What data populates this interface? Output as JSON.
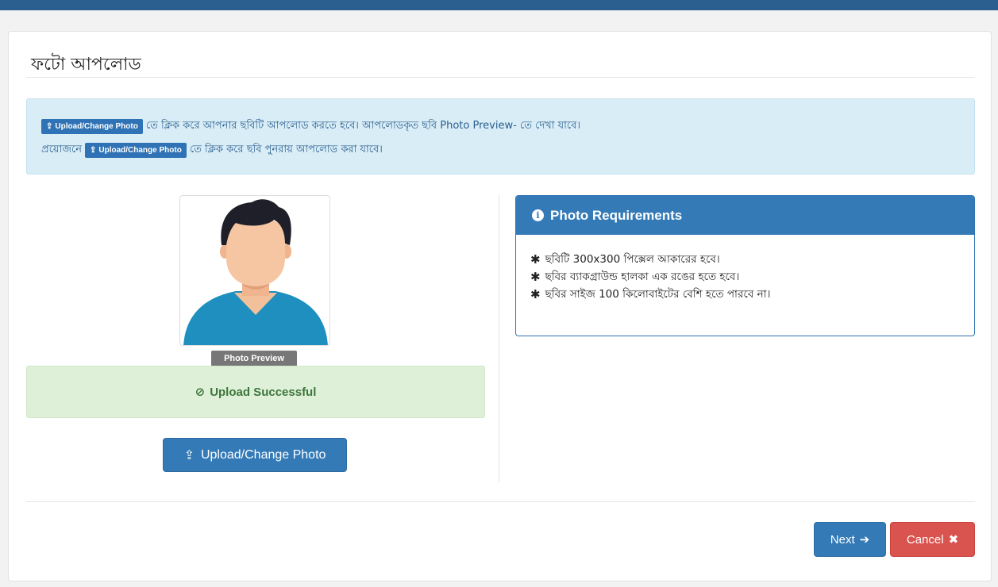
{
  "page": {
    "title": "ফটো আপলোড"
  },
  "info": {
    "line1_button": "Upload/Change Photo",
    "line1_text": "তে ক্লিক করে আপনার ছবিটি আপলোড করতে হবে। আপলোডকৃত ছবি Photo Preview- তে দেখা যাবে।",
    "line2_prefix": "প্রয়োজনে",
    "line2_button": "Upload/Change Photo",
    "line2_text": "তে ক্লিক করে ছবি পুনরায় আপলোড করা যাবে।"
  },
  "preview": {
    "label": "Photo Preview",
    "success_icon": "check-circle-icon",
    "success_text": "Upload Successful",
    "upload_icon": "upload-icon",
    "upload_label": "Upload/Change Photo"
  },
  "requirements": {
    "icon": "info-circle-icon",
    "title": "Photo Requirements",
    "items": [
      "ছবিটি 300x300 পিক্সেল আকারের হবে।",
      "ছবির ব্যাকগ্রাউন্ড হালকা এক রঙের হতে হবে।",
      "ছবির সাইজ 100 কিলোবাইটের বেশি হতে পারবে না।"
    ]
  },
  "actions": {
    "next_label": "Next",
    "next_icon": "arrow-right-icon",
    "cancel_label": "Cancel",
    "cancel_icon": "close-icon"
  },
  "colors": {
    "primary": "#337ab7",
    "danger": "#d9534f",
    "success_bg": "#dff0d8",
    "info_bg": "#d9edf7",
    "topbar": "#2a5f8f"
  }
}
